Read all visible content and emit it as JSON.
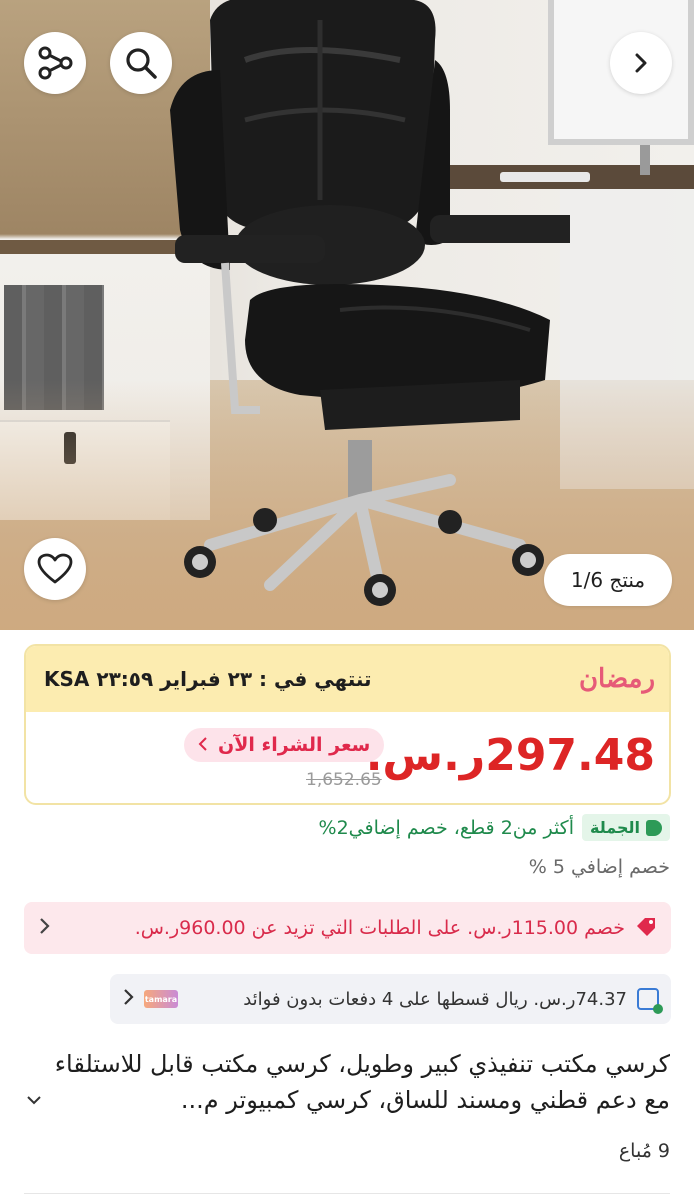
{
  "hero": {
    "counter": "منتج 1/6",
    "icons": {
      "share": "share-icon",
      "search": "search-icon",
      "next": "chevron-right-icon",
      "wishlist": "heart-icon"
    }
  },
  "price_card": {
    "campaign_logo": "رمضان",
    "ends_text": "تنتهي في : ٢٣ فبراير ٢٣:٥٩ KSA",
    "price": "297.48ر.س.",
    "buy_now_label": "سعر الشراء الآن",
    "old_price": "1,652.65",
    "colors": {
      "price": "#dd2525",
      "banner": "#fcecb0",
      "accent": "#e0294c"
    }
  },
  "offers": {
    "wholesale_badge": "الجملة",
    "wholesale_text": "أكثر من2 قطع، خصم إضافي2%",
    "extra_discount": "خصم إضافي 5 %",
    "coupon_text": "خصم 115.00ر.س. على الطلبات التي تزيد عن 960.00ر.س.",
    "installment_text": "74.37ر.س. ريال قسطها على 4 دفعات بدون فوائد",
    "installment_provider": "tamara"
  },
  "product": {
    "title": "كرسي مكتب تنفيذي كبير وطويل، كرسي مكتب قابل للاستلقاء مع دعم قطني ومسند للساق، كرسي كمبيوتر م...",
    "sold": "9 مُباع"
  }
}
